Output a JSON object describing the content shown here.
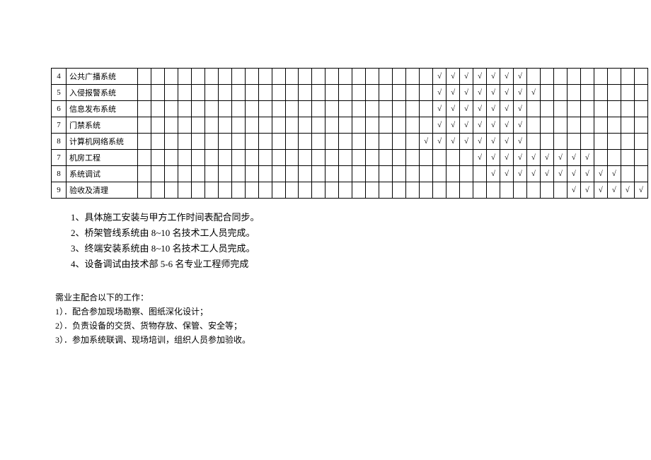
{
  "chart_data": {
    "type": "table",
    "num_cells": 38,
    "rows": [
      {
        "num": "4",
        "name": "公共广播系统",
        "checks": [
          23,
          24,
          25,
          26,
          27,
          28,
          29
        ]
      },
      {
        "num": "5",
        "name": "入侵报警系统",
        "checks": [
          23,
          24,
          25,
          26,
          27,
          28,
          29,
          30
        ]
      },
      {
        "num": "6",
        "name": "信息发布系统",
        "checks": [
          23,
          24,
          25,
          26,
          27,
          28,
          29
        ]
      },
      {
        "num": "7",
        "name": "门禁系统",
        "checks": [
          23,
          24,
          25,
          26,
          27,
          28,
          29
        ]
      },
      {
        "num": "8",
        "name": "计算机网络系统",
        "checks": [
          22,
          23,
          24,
          25,
          26,
          27,
          28,
          29
        ]
      },
      {
        "num": "7",
        "name": "机房工程",
        "checks": [
          26,
          27,
          28,
          29,
          30,
          31,
          32,
          33,
          34
        ]
      },
      {
        "num": "8",
        "name": "系统调试",
        "checks": [
          27,
          28,
          29,
          30,
          31,
          32,
          33,
          34,
          35,
          36
        ]
      },
      {
        "num": "9",
        "name": "验收及清理",
        "checks": [
          33,
          34,
          35,
          36,
          37,
          38
        ]
      }
    ]
  },
  "notes": {
    "n1": "1、具体施工安装与甲方工作时间表配合同步。",
    "n2": "2、桥架管线系统由 8~10 名技术工人员完成。",
    "n3": "3、终端安装系统由 8~10 名技术工人员完成。",
    "n4": "4、设备调试由技术部 5-6 名专业工程师完成"
  },
  "owner": {
    "title": "需业主配合以下的工作：",
    "o1": "1）．配合参加现场勘察、图纸深化设计；",
    "o2": "2）．负责设备的交货、货物存放、保管、安全等；",
    "o3": "3）．参加系统联调、现场培训，组织人员参加验收。"
  },
  "check_mark": "√"
}
